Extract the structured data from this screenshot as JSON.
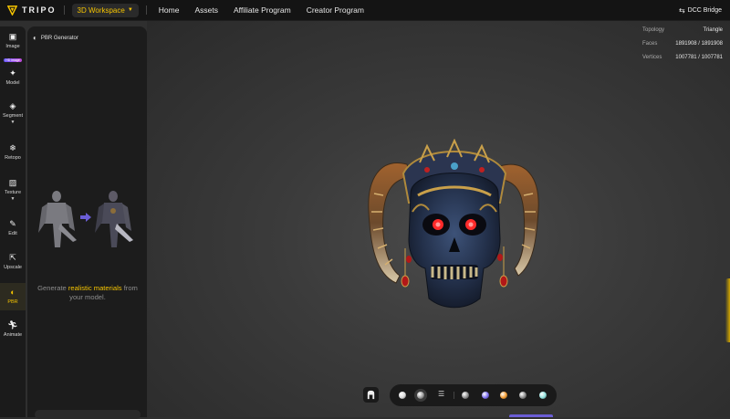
{
  "header": {
    "logo_text": "TRIPO",
    "workspace_label": "3D Workspace",
    "nav": [
      "Home",
      "Assets",
      "Affiliate Program",
      "Creator Program"
    ],
    "dcc_label": "DCC Bridge"
  },
  "toolbar": {
    "items": [
      {
        "label": "Image",
        "icon": "image-icon",
        "badge": "HD image"
      },
      {
        "label": "Model",
        "icon": "sparkle-icon"
      },
      {
        "label": "Segment",
        "icon": "cube-icon"
      },
      {
        "label": "Retopo",
        "icon": "grid-icon"
      },
      {
        "label": "Texture",
        "icon": "texture-icon"
      },
      {
        "label": "Edit",
        "icon": "brush-icon"
      },
      {
        "label": "Upscale",
        "icon": "upscale-icon"
      },
      {
        "label": "PBR",
        "icon": "pbr-icon"
      },
      {
        "label": "Animate",
        "icon": "figure-icon"
      }
    ],
    "active": "PBR",
    "accent": "#f5c400"
  },
  "panel": {
    "title": "PBR Generator",
    "caption_prefix": "Generate",
    "caption_highlight": "realistic materials",
    "caption_suffix": "from your model."
  },
  "stats": {
    "topology_label": "Topology",
    "topology_value": "Triangle",
    "faces_label": "Faces",
    "faces_value": "1891908 / 1891908",
    "vertices_label": "Vertices",
    "vertices_value": "1007781 / 1007781"
  },
  "controls": {
    "orb_colors": [
      "#d8d8d8",
      "#9a9a9a",
      "#8c8c8c",
      "#7b6cf0",
      "#f29a2e",
      "#888888",
      "#8fe0dc"
    ]
  }
}
